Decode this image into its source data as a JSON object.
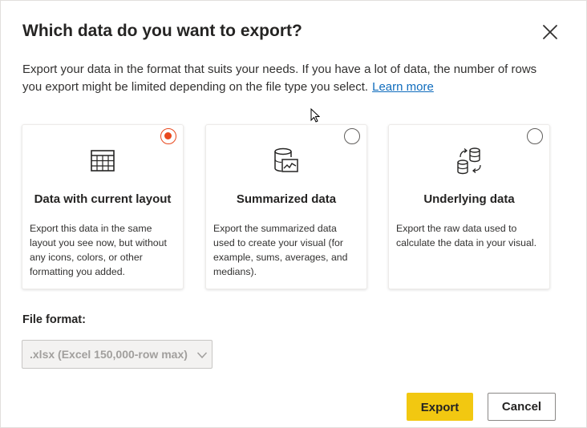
{
  "dialog": {
    "title": "Which data do you want to export?",
    "description": "Export your data in the format that suits your needs. If you have a lot of data, the number of rows you export might be limited depending on the file type you select.",
    "learn_more": "Learn more"
  },
  "options": [
    {
      "title": "Data with current layout",
      "description": "Export this data in the same layout you see now, but without any icons, colors, or other formatting you added.",
      "selected": true,
      "icon": "table-icon"
    },
    {
      "title": "Summarized data",
      "description": "Export the summarized data used to create your visual (for example, sums, averages, and medians).",
      "selected": false,
      "icon": "database-chart-icon"
    },
    {
      "title": "Underlying data",
      "description": "Export the raw data used to calculate the data in your visual.",
      "selected": false,
      "icon": "database-sync-icon"
    }
  ],
  "file_format": {
    "label": "File format:",
    "value": ".xlsx (Excel 150,000-row max)"
  },
  "buttons": {
    "export": "Export",
    "cancel": "Cancel"
  },
  "colors": {
    "accent_radio": "#e8481d",
    "export_button": "#f2c811",
    "link": "#0f6cbd"
  }
}
